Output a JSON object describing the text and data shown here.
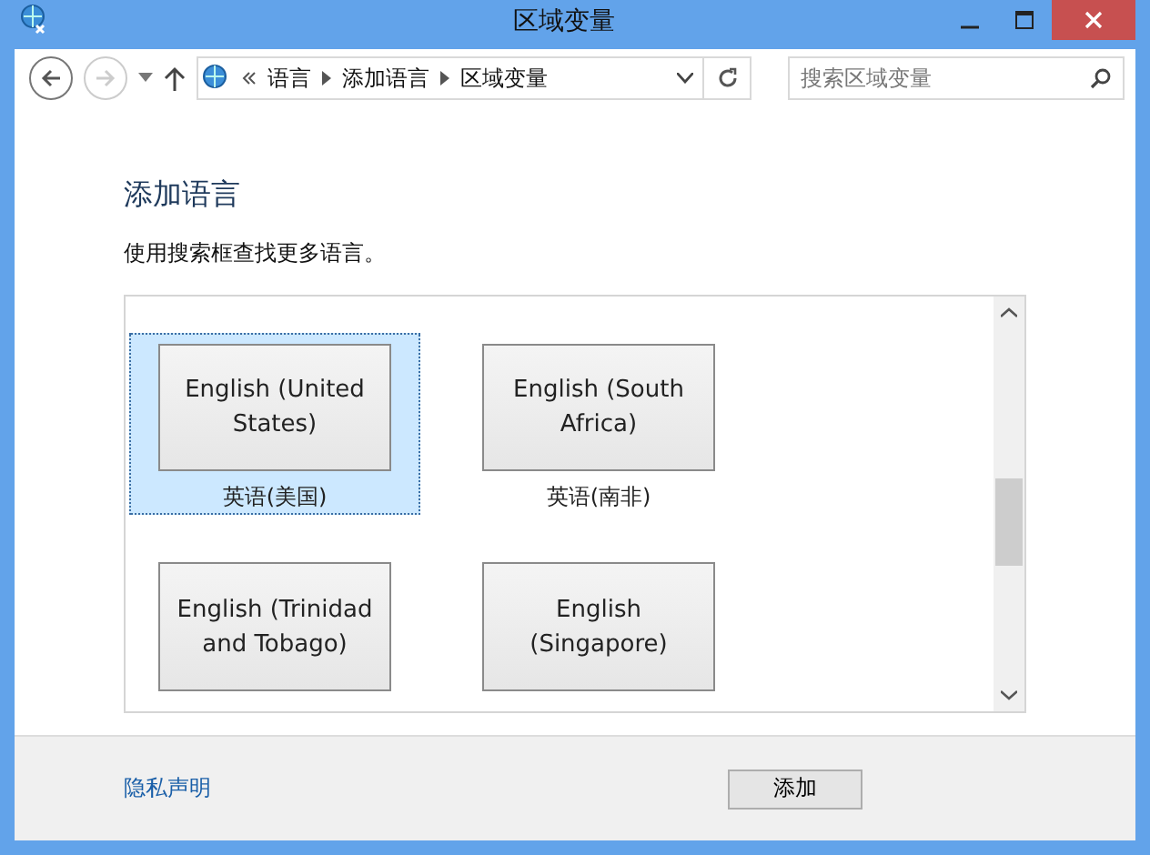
{
  "window": {
    "title": "区域变量"
  },
  "nav": {
    "back_disabled": false,
    "forward_disabled": true,
    "breadcrumb": [
      "语言",
      "添加语言",
      "区域变量"
    ],
    "search": {
      "placeholder": "搜索区域变量"
    }
  },
  "heading": "添加语言",
  "instruction": "使用搜索框查找更多语言。",
  "languages": [
    {
      "name": "English (United States)",
      "native": "英语(美国)",
      "selected": true
    },
    {
      "name": "English (South Africa)",
      "native": "英语(南非)",
      "selected": false
    },
    {
      "name": "English (Trinidad and Tobago)",
      "selected": false
    },
    {
      "name": "English (Singapore)",
      "selected": false
    }
  ],
  "footer": {
    "link": "隐私声明",
    "button": "添加"
  }
}
